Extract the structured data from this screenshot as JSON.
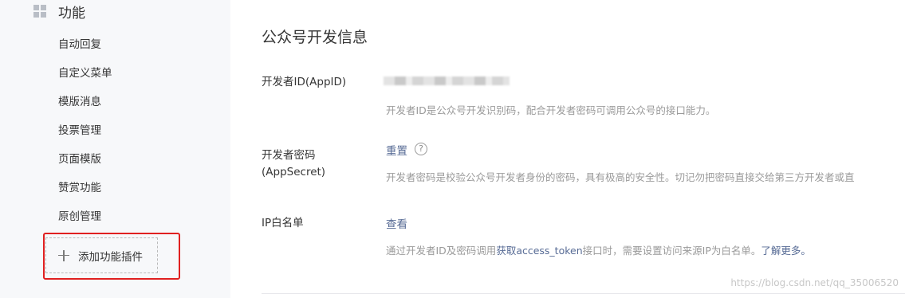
{
  "sidebar": {
    "section_title": "功能",
    "items": [
      {
        "label": "自动回复"
      },
      {
        "label": "自定义菜单"
      },
      {
        "label": "模版消息"
      },
      {
        "label": "投票管理"
      },
      {
        "label": "页面模版"
      },
      {
        "label": "赞赏功能"
      },
      {
        "label": "原创管理"
      }
    ],
    "add_plugin_label": "添加功能插件",
    "highlight_color": "#e02020"
  },
  "main": {
    "title": "公众号开发信息",
    "app_id": {
      "label": "开发者ID(AppID)",
      "value_masked": true,
      "description": "开发者ID是公众号开发识别码，配合开发者密码可调用公众号的接口能力。"
    },
    "app_secret": {
      "label_line1": "开发者密码",
      "label_line2": "(AppSecret)",
      "action": "重置",
      "help": "?",
      "description": "开发者密码是校验公众号开发者身份的密码，具有极高的安全性。切记勿把密码直接交给第三方开发者或直"
    },
    "ip_whitelist": {
      "label": "IP白名单",
      "action": "查看",
      "description_part1": "通过开发者ID及密码调用",
      "description_part2": "获取access_token",
      "description_part3": "接口时，需要设置访问来源IP为白名单。",
      "learn_more": "了解更多。"
    },
    "link_color": "#576b95"
  },
  "watermark": "https://blog.csdn.net/qq_35006520"
}
